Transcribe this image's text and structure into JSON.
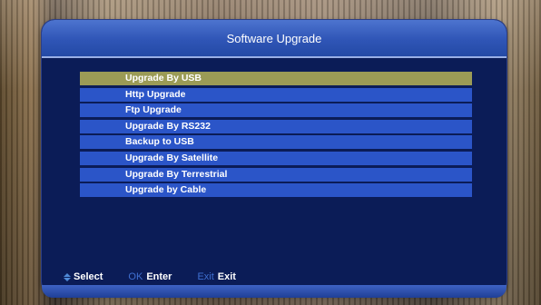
{
  "dialog": {
    "title": "Software Upgrade"
  },
  "menu": {
    "items": [
      {
        "label": "Upgrade By USB",
        "selected": true
      },
      {
        "label": "Http Upgrade"
      },
      {
        "label": "Ftp Upgrade"
      },
      {
        "label": "Upgrade By RS232"
      },
      {
        "label": "Backup to USB"
      },
      {
        "label": "Upgrade By Satellite"
      },
      {
        "label": "Upgrade By Terrestrial"
      },
      {
        "label": "Upgrade by Cable"
      }
    ]
  },
  "footer": {
    "select": {
      "icon": "up-down-arrows-icon",
      "label": "Select"
    },
    "enter": {
      "key": "OK",
      "label": "Enter",
      "key_color": "#3f6fd0"
    },
    "exit": {
      "key": "Exit",
      "label": "Exit",
      "key_color": "#3f6fd0"
    }
  },
  "colors": {
    "panel": "#0b1c57",
    "menu_item": "#2b55c8",
    "menu_item_selected": "#9b9b56",
    "title_bar": "#2f55b6"
  }
}
